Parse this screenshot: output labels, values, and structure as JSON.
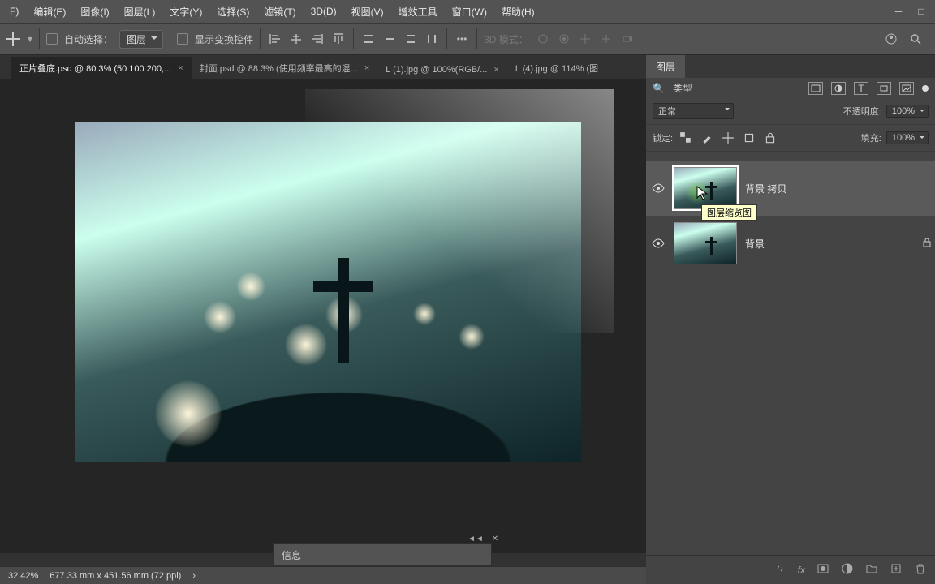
{
  "menu": {
    "file": "F)",
    "edit": "编辑(E)",
    "image": "图像(I)",
    "layer": "图层(L)",
    "type": "文字(Y)",
    "select": "选择(S)",
    "filter": "滤镜(T)",
    "d3": "3D(D)",
    "view": "视图(V)",
    "enhance": "增效工具",
    "window": "窗口(W)",
    "help": "帮助(H)"
  },
  "options": {
    "auto": "自动选择：",
    "layer_dd": "图层",
    "transform": "显示变换控件",
    "d3mode": "3D 模式："
  },
  "tabs": [
    {
      "label": "正片叠底.psd @ 80.3% (50   100   200,...",
      "active": true
    },
    {
      "label": "封面.psd @ 88.3% (使用频率最高的混...",
      "active": false
    },
    {
      "label": "L (1).jpg @ 100%(RGB/...",
      "active": false
    },
    {
      "label": "L (4).jpg @ 114% (图",
      "active": false
    }
  ],
  "layers_panel": {
    "tab": "图层",
    "filter_label": "类型",
    "blend": "正常",
    "opacity_lbl": "不透明度:",
    "opacity": "100%",
    "lock_lbl": "锁定:",
    "fill_lbl": "填充:",
    "fill": "100%",
    "items": [
      {
        "name": "背景 拷贝",
        "selected": true,
        "tooltip": "图层缩览图"
      },
      {
        "name": "背景",
        "selected": false,
        "locked": true
      }
    ]
  },
  "status": {
    "zoom": "32.42%",
    "dims": "677.33 mm x 451.56 mm (72 ppi)",
    "info": "信息"
  }
}
